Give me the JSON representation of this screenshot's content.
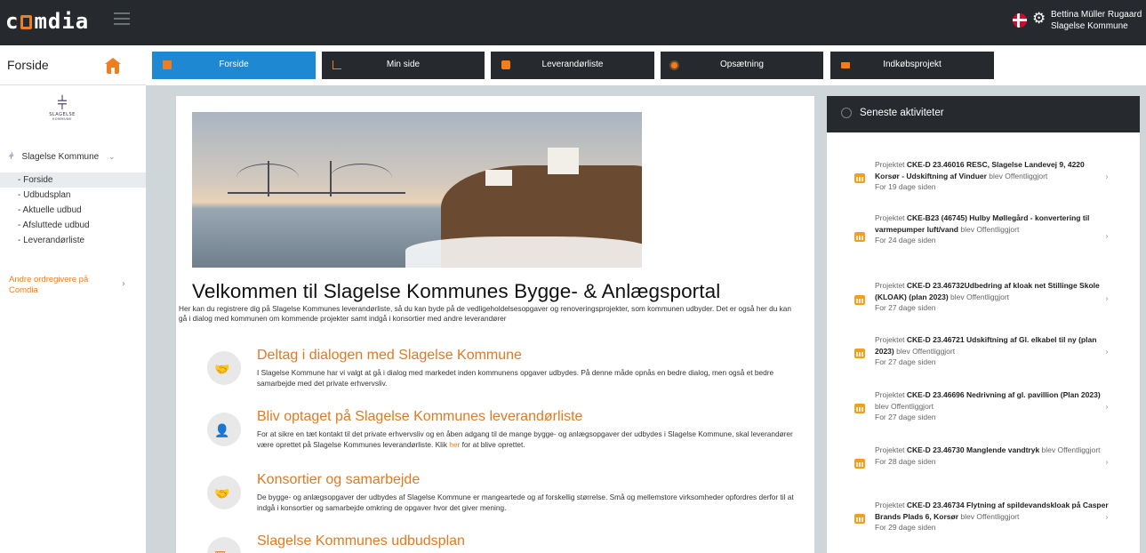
{
  "topbar": {
    "logo": "comdia",
    "user_name": "Bettina Müller Rugaard",
    "user_org": "Slagelse Kommune"
  },
  "nav": {
    "current_page": "Forside",
    "tabs": [
      {
        "label": "Forside",
        "icon": "home-icon",
        "active": true
      },
      {
        "label": "Min side",
        "icon": "bar-chart-icon",
        "active": false
      },
      {
        "label": "Leverandørliste",
        "icon": "list-icon",
        "active": false
      },
      {
        "label": "Opsætning",
        "icon": "sun-icon",
        "active": false
      },
      {
        "label": "Indkøbsprojekt",
        "icon": "money-icon",
        "active": false
      }
    ]
  },
  "sidebar": {
    "logo_text": "SLAGELSE",
    "logo_sub": "KOMMUNE",
    "org": "Slagelse Kommune",
    "items": [
      {
        "label": "- Forside",
        "active": true
      },
      {
        "label": "- Udbudsplan",
        "active": false
      },
      {
        "label": "- Aktuelle udbud",
        "active": false
      },
      {
        "label": "- Afsluttede udbud",
        "active": false
      },
      {
        "label": "- Leverandørliste",
        "active": false
      }
    ],
    "other": "Andre ordregivere på Comdia"
  },
  "main": {
    "title": "Velkommen til Slagelse Kommunes Bygge- & Anlægsportal",
    "intro": "Her kan du registrere dig på Slagelse Kommunes leverandørliste, så du kan byde på de vedligeholdelsesopgaver og renoveringsprojekter, som kommunen udbyder. Det er også her du kan gå i dialog med kommunen om kommende projekter samt indgå i konsortier med andre leverandører",
    "sections": [
      {
        "heading": "Deltag i dialogen med Slagelse Kommune",
        "text": "I Slagelse Kommune har vi valgt at gå i dialog med markedet inden kommunens opgaver udbydes. På denne måde opnås en bedre dialog, men også et bedre samarbejde med det private erhvervsliv.",
        "icon": "handshake-icon"
      },
      {
        "heading": "Bliv optaget på Slagelse Kommunes leverandørliste",
        "text_before": "For at sikre en tæt kontakt til det private erhvervsliv og en åben adgang til de mange bygge- og anlægsopgaver der udbydes i Slagelse Kommune, skal leverandører være oprettet på Slagelse Kommunes leverandørliste. Klik ",
        "link": "her",
        "text_after": " for at blive oprettet.",
        "icon": "person-document-icon"
      },
      {
        "heading": "Konsortier og samarbejde",
        "text": "De bygge- og anlægsopgaver der udbydes af Slagelse Kommune er mangeartede og af forskellig størrelse. Små og mellemstore virksomheder opfordres derfor til at indgå i konsortier og samarbejde omkring de opgaver hvor det giver mening.",
        "icon": "handshake-icon"
      },
      {
        "heading": "Slagelse Kommunes udbudsplan",
        "text": "",
        "icon": "calendar-icon"
      }
    ]
  },
  "activity": {
    "title": "Seneste aktiviteter",
    "items": [
      {
        "prefix": "Projektet ",
        "project": "CKE-D 23.46016 RESC, Slagelse Landevej 9, 4220 Korsør - Udskiftning af Vinduer",
        "suffix": " blev Offentliggjort",
        "time": "For 19 dage siden"
      },
      {
        "prefix": "Projektet ",
        "project": "CKE-B23 (46745) Hulby Møllegård - konvertering til varmepumper luft/vand",
        "suffix": " blev Offentliggjort",
        "time": "For 24 dage siden"
      },
      {
        "prefix": "Projektet ",
        "project": "CKE-D 23.46732Udbedring af kloak net Stillinge Skole (KLOAK) (plan 2023)",
        "suffix": " blev Offentliggjort",
        "time": "For 27 dage siden"
      },
      {
        "prefix": "Projektet ",
        "project": "CKE-D 23.46721 Udskiftning af Gl. elkabel til ny (plan 2023)",
        "suffix": " blev Offentliggjort",
        "time": "For 27 dage siden"
      },
      {
        "prefix": "Projektet ",
        "project": "CKE-D 23.46696 Nedrivning af gl. pavillion (Plan 2023)",
        "suffix": " blev Offentliggjort",
        "time": "For 27 dage siden"
      },
      {
        "prefix": "Projektet ",
        "project": "CKE-D 23.46730 Manglende vandtryk",
        "suffix": " blev Offentliggjort",
        "time": "For 28 dage siden"
      },
      {
        "prefix": "Projektet ",
        "project": "CKE-D 23.46734 Flytning af spildevandskloak på Casper Brands Plads 6, Korsør",
        "suffix": " blev Offentliggjort",
        "time": "For 29 dage siden"
      }
    ]
  },
  "colors": {
    "accent": "#f07e1f",
    "active_tab": "#1e88d2",
    "dark": "#262a2e"
  }
}
